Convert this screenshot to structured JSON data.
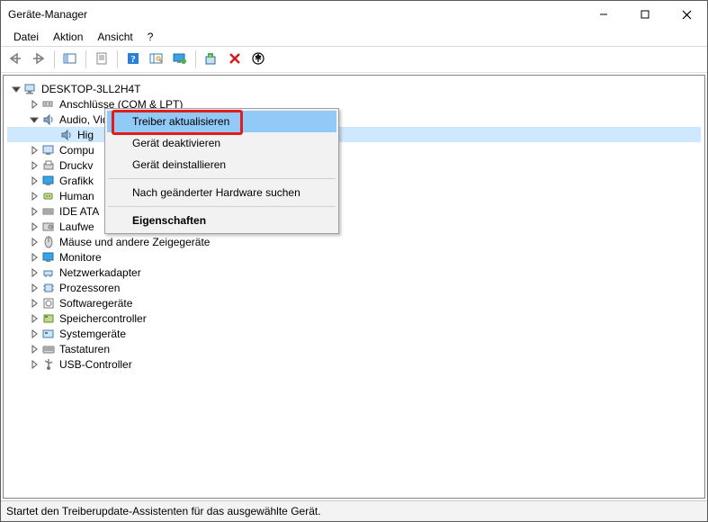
{
  "window": {
    "title": "Geräte-Manager"
  },
  "menus": {
    "file": "Datei",
    "action": "Aktion",
    "view": "Ansicht",
    "help": "?"
  },
  "toolbar_icons": {
    "back": "back-icon",
    "forward": "forward-icon",
    "show_hide": "show-hide-tree-icon",
    "properties": "properties-icon",
    "help": "help-icon",
    "scan": "scan-icon",
    "monitor": "monitor-icon",
    "enable": "enable-device-icon",
    "disable": "disable-device-icon",
    "update": "update-driver-icon"
  },
  "tree": {
    "root": "DESKTOP-3LL2H4T",
    "nodes": [
      {
        "label": "Anschlüsse (COM & LPT)",
        "icon": "ports"
      },
      {
        "label": "Audio, Video und Gamecontroller",
        "icon": "audio",
        "expanded": true,
        "children": [
          {
            "label": "High Definition Audio-Gerät",
            "icon": "audio",
            "selected": true,
            "cut": "Hig"
          }
        ]
      },
      {
        "label": "Compu",
        "icon": "computer",
        "cut": true
      },
      {
        "label": "Druckv",
        "icon": "printqueue",
        "cut": true
      },
      {
        "label": "Grafikk",
        "icon": "display",
        "cut": true
      },
      {
        "label": "Human",
        "icon": "hid",
        "cut": true
      },
      {
        "label": "IDE ATA",
        "icon": "ide",
        "cut": true
      },
      {
        "label": "Laufwe",
        "icon": "disk",
        "cut": true
      },
      {
        "label": "Mäuse und andere Zeigegeräte",
        "icon": "mouse"
      },
      {
        "label": "Monitore",
        "icon": "monitor"
      },
      {
        "label": "Netzwerkadapter",
        "icon": "network"
      },
      {
        "label": "Prozessoren",
        "icon": "cpu"
      },
      {
        "label": "Softwaregeräte",
        "icon": "software"
      },
      {
        "label": "Speichercontroller",
        "icon": "storage"
      },
      {
        "label": "Systemgeräte",
        "icon": "system"
      },
      {
        "label": "Tastaturen",
        "icon": "keyboard"
      },
      {
        "label": "USB-Controller",
        "icon": "usb"
      }
    ]
  },
  "context_menu": {
    "items": [
      {
        "label": "Treiber aktualisieren",
        "highlighted": true
      },
      {
        "label": "Gerät deaktivieren"
      },
      {
        "label": "Gerät deinstallieren"
      },
      {
        "sep": true
      },
      {
        "label": "Nach geänderter Hardware suchen"
      },
      {
        "sep": true
      },
      {
        "label": "Eigenschaften",
        "bold": true
      }
    ]
  },
  "statusbar": {
    "text": "Startet den Treiberupdate-Assistenten für das ausgewählte Gerät."
  }
}
